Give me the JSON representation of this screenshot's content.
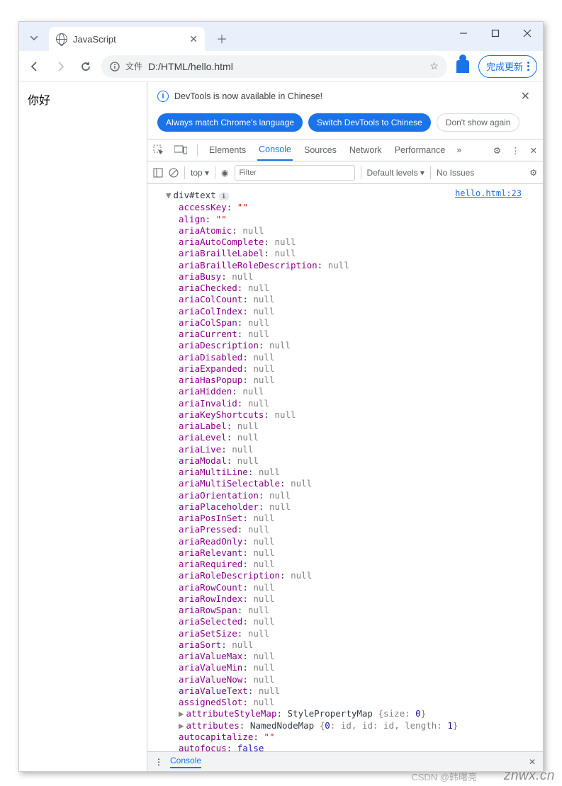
{
  "tab": {
    "title": "JavaScript"
  },
  "nav": {
    "file_label": "文件",
    "url": "D:/HTML/hello.html",
    "update_btn": "完成更新"
  },
  "page": {
    "greeting": "你好"
  },
  "infobar": {
    "message": "DevTools is now available in Chinese!",
    "btn_always": "Always match Chrome's language",
    "btn_switch": "Switch DevTools to Chinese",
    "btn_dont": "Don't show again"
  },
  "dt_tabs": [
    "Elements",
    "Console",
    "Sources",
    "Network",
    "Performance"
  ],
  "dt_active": "Console",
  "toolbar": {
    "top": "top",
    "filter_ph": "Filter",
    "levels": "Default levels",
    "issues": "No Issues"
  },
  "console": {
    "link": "hello.html:23",
    "header": "div#text",
    "props": [
      {
        "k": "accessKey",
        "v": "\"\"",
        "t": "str"
      },
      {
        "k": "align",
        "v": "\"\"",
        "t": "str"
      },
      {
        "k": "ariaAtomic",
        "v": "null",
        "t": "null"
      },
      {
        "k": "ariaAutoComplete",
        "v": "null",
        "t": "null"
      },
      {
        "k": "ariaBrailleLabel",
        "v": "null",
        "t": "null"
      },
      {
        "k": "ariaBrailleRoleDescription",
        "v": "null",
        "t": "null"
      },
      {
        "k": "ariaBusy",
        "v": "null",
        "t": "null"
      },
      {
        "k": "ariaChecked",
        "v": "null",
        "t": "null"
      },
      {
        "k": "ariaColCount",
        "v": "null",
        "t": "null"
      },
      {
        "k": "ariaColIndex",
        "v": "null",
        "t": "null"
      },
      {
        "k": "ariaColSpan",
        "v": "null",
        "t": "null"
      },
      {
        "k": "ariaCurrent",
        "v": "null",
        "t": "null"
      },
      {
        "k": "ariaDescription",
        "v": "null",
        "t": "null"
      },
      {
        "k": "ariaDisabled",
        "v": "null",
        "t": "null"
      },
      {
        "k": "ariaExpanded",
        "v": "null",
        "t": "null"
      },
      {
        "k": "ariaHasPopup",
        "v": "null",
        "t": "null"
      },
      {
        "k": "ariaHidden",
        "v": "null",
        "t": "null"
      },
      {
        "k": "ariaInvalid",
        "v": "null",
        "t": "null"
      },
      {
        "k": "ariaKeyShortcuts",
        "v": "null",
        "t": "null"
      },
      {
        "k": "ariaLabel",
        "v": "null",
        "t": "null"
      },
      {
        "k": "ariaLevel",
        "v": "null",
        "t": "null"
      },
      {
        "k": "ariaLive",
        "v": "null",
        "t": "null"
      },
      {
        "k": "ariaModal",
        "v": "null",
        "t": "null"
      },
      {
        "k": "ariaMultiLine",
        "v": "null",
        "t": "null"
      },
      {
        "k": "ariaMultiSelectable",
        "v": "null",
        "t": "null"
      },
      {
        "k": "ariaOrientation",
        "v": "null",
        "t": "null"
      },
      {
        "k": "ariaPlaceholder",
        "v": "null",
        "t": "null"
      },
      {
        "k": "ariaPosInSet",
        "v": "null",
        "t": "null"
      },
      {
        "k": "ariaPressed",
        "v": "null",
        "t": "null"
      },
      {
        "k": "ariaReadOnly",
        "v": "null",
        "t": "null"
      },
      {
        "k": "ariaRelevant",
        "v": "null",
        "t": "null"
      },
      {
        "k": "ariaRequired",
        "v": "null",
        "t": "null"
      },
      {
        "k": "ariaRoleDescription",
        "v": "null",
        "t": "null"
      },
      {
        "k": "ariaRowCount",
        "v": "null",
        "t": "null"
      },
      {
        "k": "ariaRowIndex",
        "v": "null",
        "t": "null"
      },
      {
        "k": "ariaRowSpan",
        "v": "null",
        "t": "null"
      },
      {
        "k": "ariaSelected",
        "v": "null",
        "t": "null"
      },
      {
        "k": "ariaSetSize",
        "v": "null",
        "t": "null"
      },
      {
        "k": "ariaSort",
        "v": "null",
        "t": "null"
      },
      {
        "k": "ariaValueMax",
        "v": "null",
        "t": "null"
      },
      {
        "k": "ariaValueMin",
        "v": "null",
        "t": "null"
      },
      {
        "k": "ariaValueNow",
        "v": "null",
        "t": "null"
      },
      {
        "k": "ariaValueText",
        "v": "null",
        "t": "null"
      },
      {
        "k": "assignedSlot",
        "v": "null",
        "t": "null"
      }
    ],
    "obj_props": [
      {
        "k": "attributeStyleMap",
        "cls": "StylePropertyMap",
        "body": "{size: 0}"
      },
      {
        "k": "attributes",
        "cls": "NamedNodeMap",
        "body": "{0: id, id: id, length: 1}"
      }
    ],
    "tail": [
      {
        "k": "autocapitalize",
        "v": "\"\"",
        "t": "str"
      },
      {
        "k": "autofocus",
        "v": "false",
        "t": "kw"
      }
    ]
  },
  "drawer": {
    "label": "Console"
  },
  "watermark": "znwx.cn",
  "watermark2": "CSDN @韩曙亮"
}
